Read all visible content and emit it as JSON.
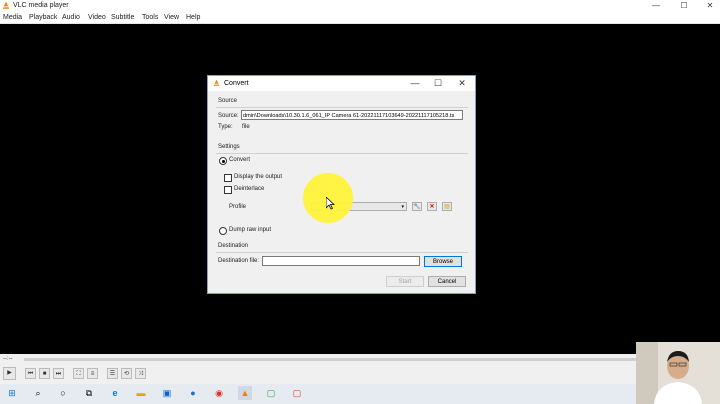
{
  "window": {
    "title": "VLC media player",
    "minimize_icon": "—",
    "maximize_icon": "☐",
    "close_icon": "✕"
  },
  "menu": [
    "Media",
    "Playback",
    "Audio",
    "Video",
    "Subtitle",
    "Tools",
    "View",
    "Help"
  ],
  "dialog": {
    "title": "Convert",
    "source": {
      "section": "Source",
      "source_label": "Source:",
      "source_value": "dmin\\Downloads\\10.30.1.6_061_IP Camera 61-20221117103649-20221117105218.ts",
      "type_label": "Type:",
      "type_value": "file"
    },
    "settings": {
      "section": "Settings",
      "convert_label": "Convert",
      "display_output_label": "Display the output",
      "deinterlace_label": "Deinterlace",
      "profile_label": "Profile",
      "dump_raw_label": "Dump raw input"
    },
    "destination": {
      "section": "Destination",
      "file_label": "Destination file:",
      "file_value": "",
      "browse_label": "Browse"
    },
    "start_label": "Start",
    "cancel_label": "Cancel"
  },
  "player": {
    "time": "--:--"
  },
  "colors": {
    "vlc_orange": "#f07e0a",
    "accent_blue": "#0078d7",
    "highlight_yellow": "#fff23a"
  }
}
